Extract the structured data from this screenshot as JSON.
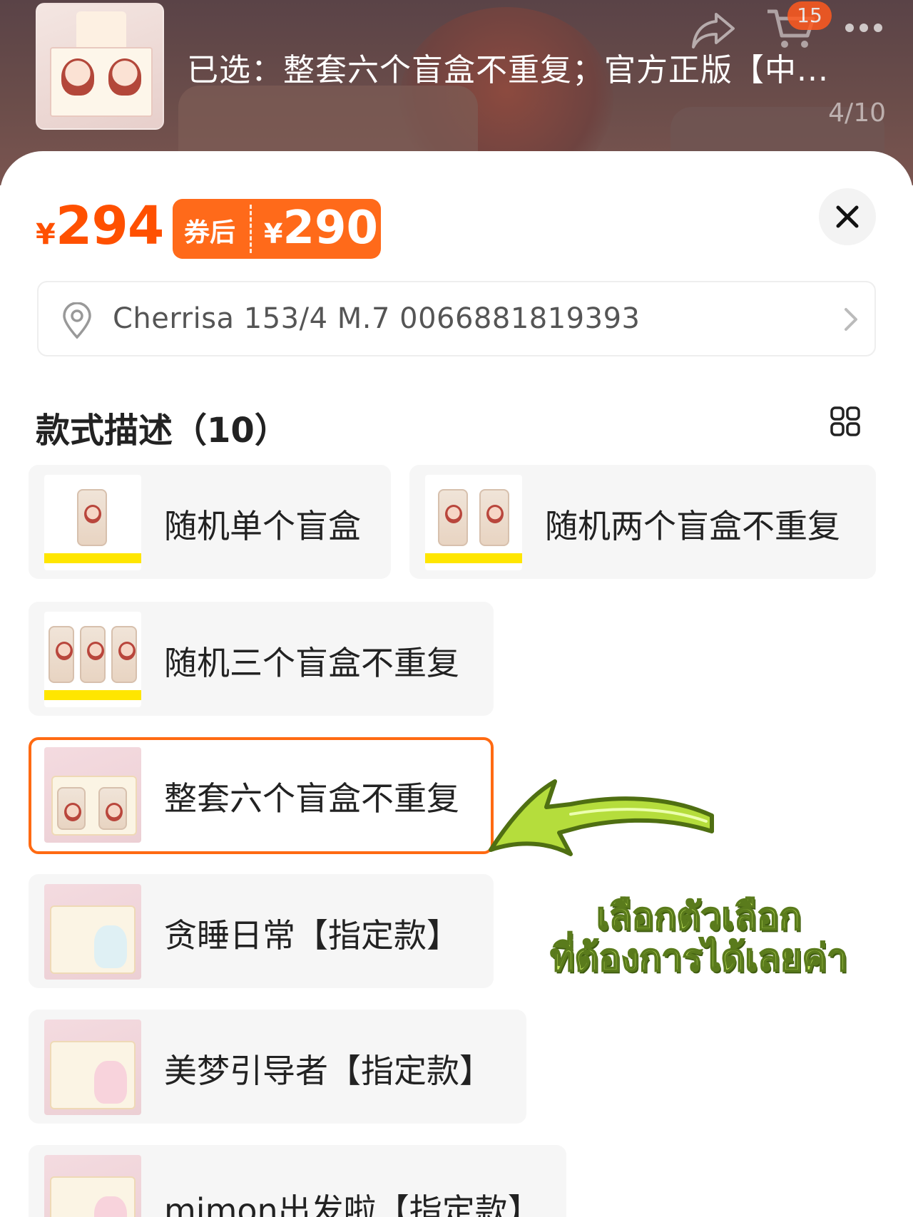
{
  "header": {
    "selected_text": "已选：整套六个盲盒不重复；官方正版【中...",
    "cart_badge": "15",
    "page_counter": "4/10",
    "icons": [
      "share-icon",
      "cart-icon",
      "more-icon"
    ]
  },
  "price": {
    "currency": "¥",
    "amount": "294",
    "coupon_label": "券后",
    "coupon_amount": "290",
    "accent_color": "#ff5000"
  },
  "address": {
    "text": "Cherrisa 153/4 M.7 0066881819393",
    "icon": "location-pin-icon"
  },
  "options_section": {
    "title": "款式描述（10）",
    "layout_toggle_icon": "grid-view-icon"
  },
  "options": [
    {
      "label": "随机单个盲盒",
      "selected": false
    },
    {
      "label": "随机两个盲盒不重复",
      "selected": false
    },
    {
      "label": "随机三个盲盒不重复",
      "selected": false
    },
    {
      "label": "整套六个盲盒不重复",
      "selected": true
    },
    {
      "label": "贪睡日常【指定款】",
      "selected": false
    },
    {
      "label": "美梦引导者【指定款】",
      "selected": false
    },
    {
      "label": "mimon出发啦【指定款】",
      "selected": false
    }
  ],
  "annotation": {
    "line1": "เลือกตัวเลือก",
    "line2": "ที่ต้องการได้เลยค่า",
    "color": "#c9ec63"
  }
}
